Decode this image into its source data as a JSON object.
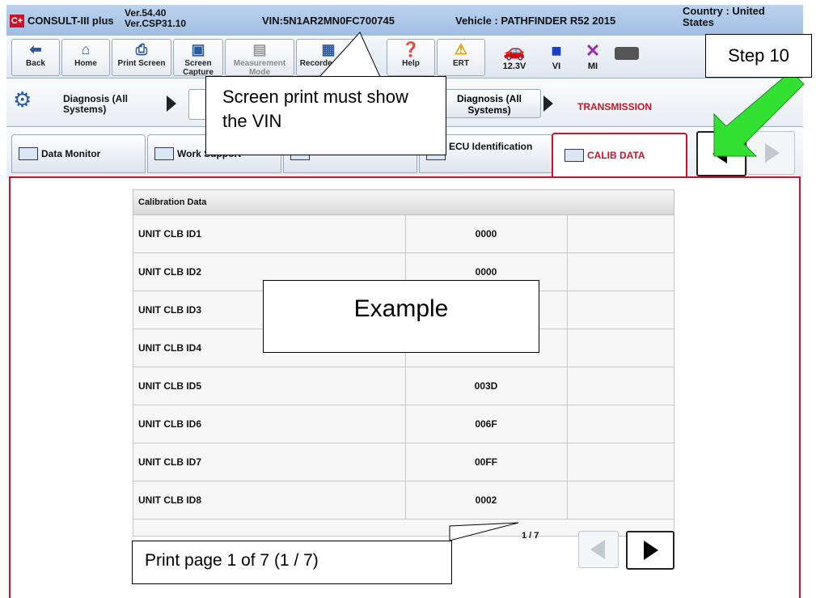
{
  "titlebar": {
    "logo": "C+",
    "app_name": "CONSULT-III plus",
    "version_line1": "Ver.54.40",
    "version_line2": "Ver.CSP31.10",
    "vin": "VIN:5N1AR2MN0FC700745",
    "vehicle": "Vehicle : PATHFINDER R52 2015",
    "country_line1": "Country : United",
    "country_line2": "States"
  },
  "toolbar": {
    "back": "Back",
    "home": "Home",
    "print_screen": "Print Screen",
    "screen_capture": "Screen Capture",
    "measurement_mode": "Measurement Mode",
    "recorded_data": "Recorded Data",
    "help": "Help",
    "ert": "ERT",
    "voltage": "12.3V",
    "vi": "VI",
    "mi": "MI"
  },
  "breadcrumb": {
    "first": "Diagnosis (All Systems)",
    "second": "Diagnosis (All Systems)",
    "active": "TRANSMISSION"
  },
  "tabs": {
    "data_monitor": "Data Monitor",
    "work_support": "Work Support",
    "ecu_identification": "ECU Identification",
    "calib_data": "CALIB DATA"
  },
  "table": {
    "header": "Calibration Data",
    "rows": [
      {
        "name": "UNIT CLB ID1",
        "value": "0000"
      },
      {
        "name": "UNIT CLB ID2",
        "value": "0000"
      },
      {
        "name": "UNIT CLB ID3",
        "value": ""
      },
      {
        "name": "UNIT CLB ID4",
        "value": ""
      },
      {
        "name": "UNIT CLB ID5",
        "value": "003D"
      },
      {
        "name": "UNIT CLB ID6",
        "value": "006F"
      },
      {
        "name": "UNIT CLB ID7",
        "value": "00FF"
      },
      {
        "name": "UNIT CLB ID8",
        "value": "0002"
      }
    ],
    "page": "1 / 7"
  },
  "callouts": {
    "vin_note": "Screen print must show the VIN",
    "example": "Example",
    "step": "Step 10",
    "print_page": "Print page 1 of 7 (1 / 7)"
  },
  "colors": {
    "accent_red": "#c8142b",
    "arrow_green": "#2ee02e",
    "title_blue": "#bcd3ee"
  }
}
